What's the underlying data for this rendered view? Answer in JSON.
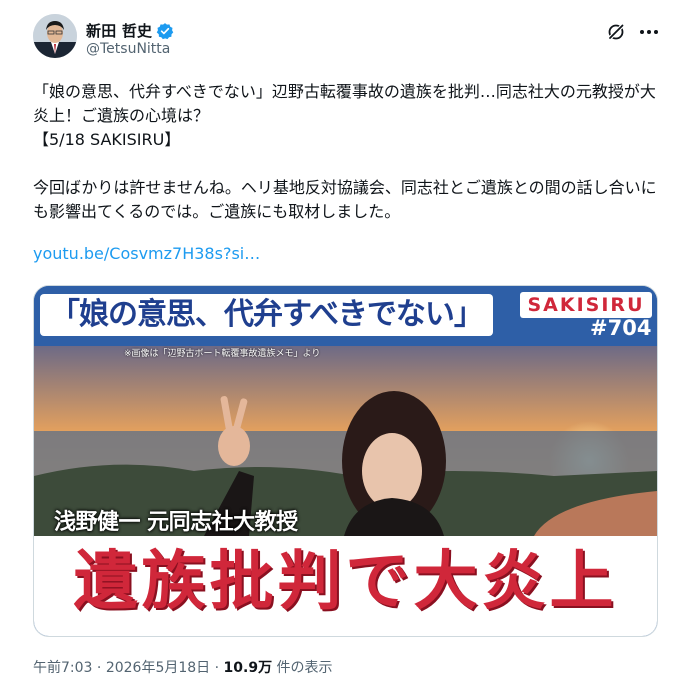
{
  "author": {
    "display_name": "新田 哲史",
    "handle": "@TetsuNitta",
    "verified": true
  },
  "icons": {
    "verified": "verified-badge-icon",
    "grok": "grok-icon",
    "more": "more-options-icon"
  },
  "tweet": {
    "text": "「娘の意思、代弁すべきでない」辺野古転覆事故の遺族を批判…同志社大の元教授が大炎上！ご遺族の心境は？\n【5/18 SAKISIRU】\n\n今回ばかりは許せませんね。ヘリ基地反対協議会、同志社とご遺族との間の話し合いにも影響出てくるのでは。ご遺族にも取材しました。",
    "link": "youtu.be/Cosvmz7H38s?si…"
  },
  "media": {
    "banner_quote": "「娘の意思、代弁すべきでない」",
    "brand": "SAKISIRU",
    "episode": "#704",
    "credit": "※画像は「辺野古ボート転覆事故遺族メモ」より",
    "subtitle": "浅野健一 元同志社大教授",
    "headline": "遺族批判で大炎上"
  },
  "meta": {
    "time": "午前7:03",
    "separator": "·",
    "date": "2026年5月18日",
    "views": "10.9万",
    "views_suffix": "件の表示"
  },
  "colors": {
    "link": "#1d9bf0",
    "verified": "#1d9bf0",
    "brand_red": "#d0273a",
    "banner_blue": "#1f3f8f"
  }
}
